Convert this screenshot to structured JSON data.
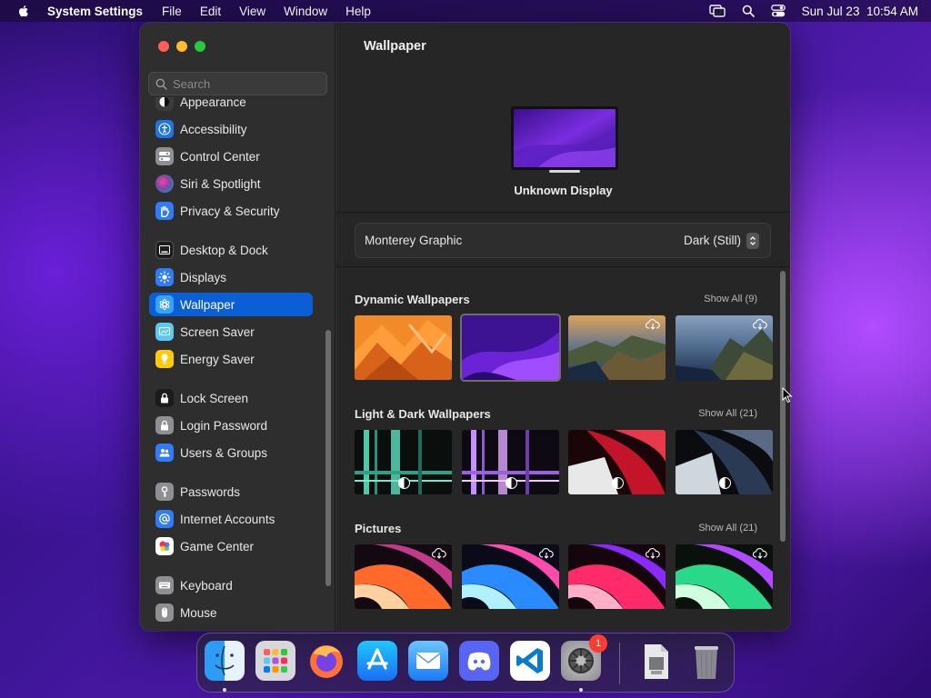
{
  "menubar": {
    "app_name": "System Settings",
    "menus": [
      "File",
      "Edit",
      "View",
      "Window",
      "Help"
    ],
    "clock": "Sun Jul 23  10:54 AM"
  },
  "search": {
    "placeholder": "Search"
  },
  "sidebar": {
    "items": [
      {
        "label": "Appearance",
        "icon": "appearance-icon"
      },
      {
        "label": "Accessibility",
        "icon": "accessibility-icon"
      },
      {
        "label": "Control Center",
        "icon": "control-center-icon"
      },
      {
        "label": "Siri & Spotlight",
        "icon": "siri-icon"
      },
      {
        "label": "Privacy & Security",
        "icon": "hand-icon"
      },
      {
        "label": "Desktop & Dock",
        "icon": "desktop-dock-icon"
      },
      {
        "label": "Displays",
        "icon": "displays-icon"
      },
      {
        "label": "Wallpaper",
        "icon": "wallpaper-icon",
        "selected": true
      },
      {
        "label": "Screen Saver",
        "icon": "screen-saver-icon"
      },
      {
        "label": "Energy Saver",
        "icon": "energy-saver-icon"
      },
      {
        "label": "Lock Screen",
        "icon": "lock-icon"
      },
      {
        "label": "Login Password",
        "icon": "login-password-icon"
      },
      {
        "label": "Users & Groups",
        "icon": "users-icon"
      },
      {
        "label": "Passwords",
        "icon": "key-icon"
      },
      {
        "label": "Internet Accounts",
        "icon": "at-icon"
      },
      {
        "label": "Game Center",
        "icon": "game-center-icon"
      },
      {
        "label": "Keyboard",
        "icon": "keyboard-icon"
      },
      {
        "label": "Mouse",
        "icon": "mouse-icon"
      }
    ]
  },
  "content": {
    "title": "Wallpaper",
    "display_name": "Unknown Display",
    "current_wallpaper": "Monterey Graphic",
    "appearance_mode": "Dark (Still)",
    "sections": [
      {
        "title": "Dynamic Wallpapers",
        "show_all": "Show All (9)"
      },
      {
        "title": "Light & Dark Wallpapers",
        "show_all": "Show All (21)"
      },
      {
        "title": "Pictures",
        "show_all": "Show All (21)"
      }
    ]
  },
  "dock": {
    "apps": [
      "Finder",
      "Launchpad",
      "Firefox",
      "App Store",
      "Mail",
      "Discord",
      "Visual Studio Code",
      "System Settings",
      "Preview",
      "Trash"
    ],
    "system_settings_badge": "1"
  },
  "colors": {
    "accent": "#0a5fd6",
    "window_bg": "#262626",
    "sidebar_bg": "#2e2e2e",
    "badge": "#ff3b30"
  }
}
